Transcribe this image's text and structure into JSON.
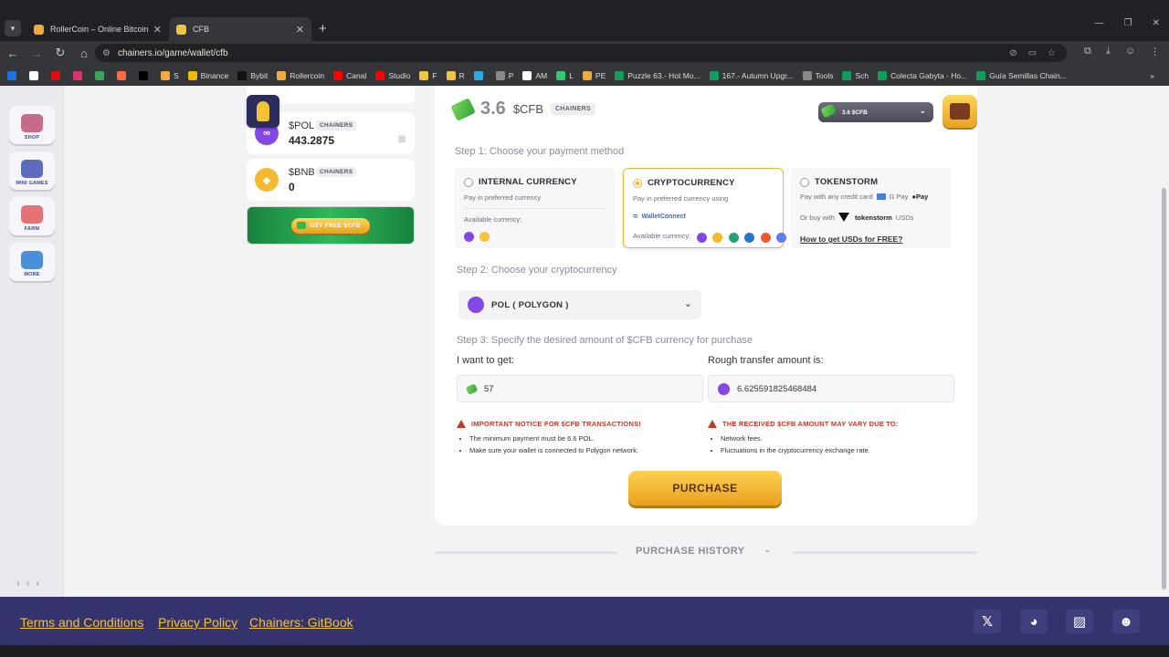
{
  "browser": {
    "tabs": [
      {
        "title": "RollerCoin – Online Bitcoin Mini",
        "fav_color": "#f2a93b"
      },
      {
        "title": "CFB",
        "fav_color": "#f2c33c"
      }
    ],
    "new_tab": "+",
    "url": "chainers.io/game/wallet/cfb",
    "bookmarks": [
      {
        "label": "",
        "color": "#1a73e8"
      },
      {
        "label": "",
        "color": "#ffffff"
      },
      {
        "label": "",
        "color": "#e50914"
      },
      {
        "label": "",
        "color": "#e1306c"
      },
      {
        "label": "",
        "color": "#34a853"
      },
      {
        "label": "",
        "color": "#ff6a3d"
      },
      {
        "label": "",
        "color": "#000000"
      },
      {
        "label": "S",
        "color": "#f2a93b"
      },
      {
        "label": "Binance",
        "color": "#f0b90b"
      },
      {
        "label": "Bybit",
        "color": "#111111"
      },
      {
        "label": "Rollercoin",
        "color": "#f2a93b"
      },
      {
        "label": "Canal",
        "color": "#ff0000"
      },
      {
        "label": "Studio",
        "color": "#ff0000"
      },
      {
        "label": "F",
        "color": "#f2c33c"
      },
      {
        "label": "R",
        "color": "#f2c33c"
      },
      {
        "label": "",
        "color": "#2aabee"
      },
      {
        "label": "P",
        "color": "#888888"
      },
      {
        "label": "AM",
        "color": "#ffffff"
      },
      {
        "label": "L",
        "color": "#2ecc71"
      },
      {
        "label": "PE",
        "color": "#f2a93b"
      },
      {
        "label": "Puzzle 63.- Hot Mo...",
        "color": "#0f9d58"
      },
      {
        "label": "167.- Autumn Upgr...",
        "color": "#0f9d58"
      },
      {
        "label": "Tools",
        "color": "#888888"
      },
      {
        "label": "Sch",
        "color": "#0f9d58"
      },
      {
        "label": "Colecta Gabyta - Ho...",
        "color": "#0f9d58"
      },
      {
        "label": "Guía Semillas Chain...",
        "color": "#0f9d58"
      }
    ]
  },
  "sidebar": {
    "items": [
      {
        "label": "SHOP",
        "color": "#c76b8a"
      },
      {
        "label": "MINI GAMES",
        "color": "#5c6bc0"
      },
      {
        "label": "FARM",
        "color": "#e57373"
      },
      {
        "label": "MORE",
        "color": "#4a90d9"
      }
    ],
    "collapse": "‹ ‹ ‹"
  },
  "wallet": {
    "coins": [
      {
        "symbol": "$POL",
        "tag": "CHAINERS",
        "amount": "443.2875",
        "color": "#8247e5"
      },
      {
        "symbol": "$BNB",
        "tag": "CHAINERS",
        "amount": "0",
        "color": "#f3ba2f"
      }
    ],
    "banner_button": "GET FREE $CFB"
  },
  "panel": {
    "balance_value": "3.6",
    "balance_currency": "$CFB",
    "balance_tag": "CHAINERS",
    "balance_select": "3.6 $CFB",
    "step1": "Step 1: Choose your payment method",
    "methods": {
      "internal": {
        "title": "INTERNAL CURRENCY",
        "subtitle": "Pay in preferred currency",
        "available": "Available currency:"
      },
      "crypto": {
        "title": "CRYPTOCURRENCY",
        "subtitle": "Pay in preferred currency using",
        "walletconnect": "WalletConnect",
        "available": "Available currency:"
      },
      "tokenstorm": {
        "title": "TOKENSTORM",
        "line1": "Pay with any credit card",
        "gpay": "G Pay",
        "applepay": "Pay",
        "line2_prefix": "Or buy with",
        "tokenstorm_logo": "tokenstorm",
        "line2_suffix": "USDs",
        "link": "How to get USDs for FREE?"
      }
    },
    "step2": "Step 2: Choose your cryptocurrency",
    "crypto_selected": "POL  ( POLYGON )",
    "step3": "Step 3: Specify the desired amount of $CFB currency for purchase",
    "want_label": "I want to get:",
    "want_value": "57",
    "transfer_label": "Rough transfer amount is:",
    "transfer_value": "6.625591825468484",
    "notice_left": {
      "title": "IMPORTANT NOTICE FOR $CFB TRANSACTIONS!",
      "items": [
        "The minimum payment must be 6.6 POL.",
        "Make sure your wallet is connected to Polygon network."
      ]
    },
    "notice_right": {
      "title": "THE RECEIVED $CFB AMOUNT MAY VARY DUE TO:",
      "items": [
        "Network fees.",
        "Fluctuations in the cryptocurrency exchange rate."
      ]
    },
    "purchase": "PURCHASE",
    "history": "PURCHASE HISTORY"
  },
  "coin_colors": {
    "internal": [
      "#8247e5",
      "#f2c33c"
    ],
    "crypto": [
      "#8247e5",
      "#f3ba2f",
      "#26a17b",
      "#2775ca",
      "#f05a28",
      "#627eea"
    ]
  },
  "footer": {
    "links": [
      "Terms and Conditions",
      "Privacy Policy",
      "Chainers: GitBook"
    ],
    "social": [
      "X",
      "D",
      "Z",
      "R"
    ]
  }
}
